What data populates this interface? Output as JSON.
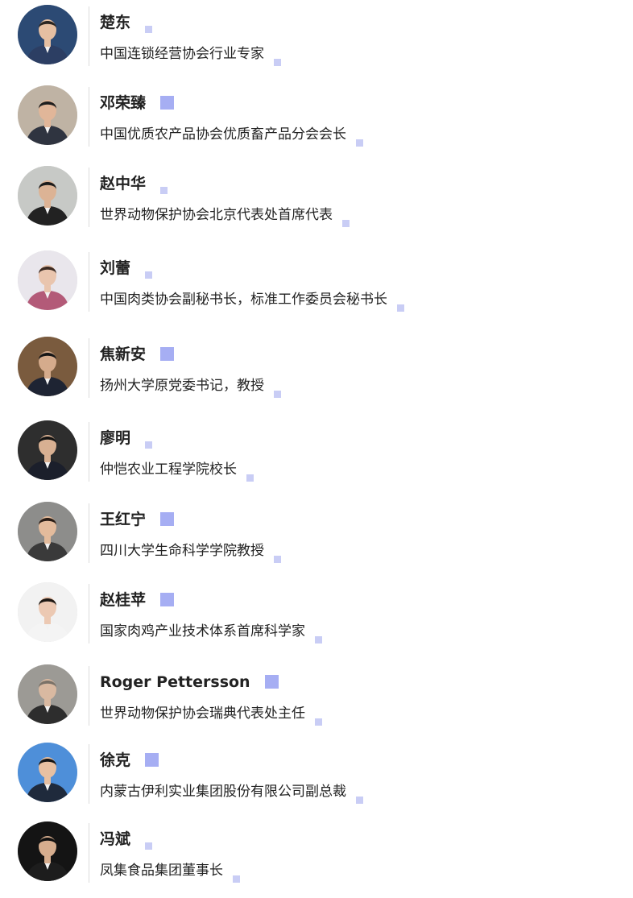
{
  "speakers": [
    {
      "name": "楚东",
      "title": "中国连锁经营协会行业专家",
      "name_marker": "small",
      "bg": "#2c4a74",
      "shirt": "#2c3e63",
      "skin": "#e5bfa2",
      "hair": "#2a2521"
    },
    {
      "name": "邓荣臻",
      "title": "中国优质农产品协会优质畜产品分会会长",
      "name_marker": "large",
      "bg": "#bfb3a4",
      "shirt": "#2f3440",
      "skin": "#e1b699",
      "hair": "#1f1f1f"
    },
    {
      "name": "赵中华",
      "title": "世界动物保护协会北京代表处首席代表",
      "name_marker": "small",
      "bg": "#c7c9c6",
      "shirt": "#222222",
      "skin": "#dcb395",
      "hair": "#1c1c1c"
    },
    {
      "name": "刘蕾",
      "title": "中国肉类协会副秘书长，标准工作委员会秘书长",
      "name_marker": "small",
      "bg": "#e9e6ec",
      "shirt": "#b35a78",
      "skin": "#e9c5ae",
      "hair": "#3b2a22"
    },
    {
      "name": "焦新安",
      "title": "扬州大学原党委书记，教授",
      "name_marker": "large",
      "bg": "#7a5b3e",
      "shirt": "#1e2433",
      "skin": "#d5ab8c",
      "hair": "#161616"
    },
    {
      "name": "廖明",
      "title": "仲恺农业工程学院校长",
      "name_marker": "small",
      "bg": "#2e2e2e",
      "shirt": "#1b1f2b",
      "skin": "#d8b092",
      "hair": "#121212"
    },
    {
      "name": "王红宁",
      "title": "四川大学生命科学学院教授",
      "name_marker": "large",
      "bg": "#8d8d8b",
      "shirt": "#3a3a3a",
      "skin": "#e3bb9c",
      "hair": "#2a1d16"
    },
    {
      "name": "赵桂苹",
      "title": "国家肉鸡产业技术体系首席科学家",
      "name_marker": "large",
      "bg": "#f2f2f2",
      "shirt": "#f4f4f4",
      "skin": "#ecc9b3",
      "hair": "#1e1814"
    },
    {
      "name": "Roger Pettersson",
      "title": "世界动物保护协会瑞典代表处主任",
      "name_marker": "large",
      "bg": "#9c9a95",
      "shirt": "#2d2d2d",
      "skin": "#d9b9a1",
      "hair": "#7a7268"
    },
    {
      "name": "徐克",
      "title": "内蒙古伊利实业集团股份有限公司副总裁",
      "name_marker": "large",
      "bg": "#4e8fd9",
      "shirt": "#1f2a3c",
      "skin": "#e7c0a2",
      "hair": "#151515"
    },
    {
      "name": "冯斌",
      "title": "凤集食品集团董事长",
      "name_marker": "small",
      "bg": "#141414",
      "shirt": "#1d1d1d",
      "skin": "#d6ad8e",
      "hair": "#0f0f0f"
    }
  ]
}
